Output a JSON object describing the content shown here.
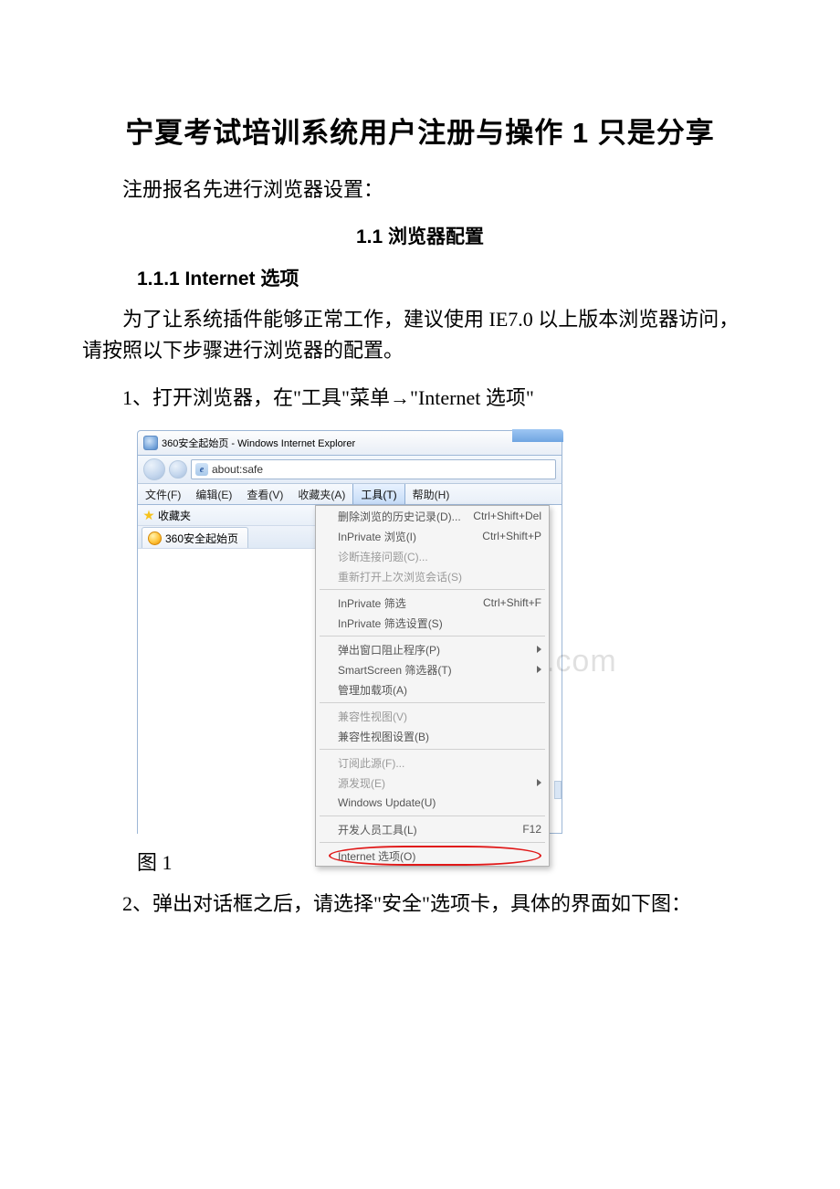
{
  "title": "宁夏考试培训系统用户注册与操作 1 只是分享",
  "intro": "注册报名先进行浏览器设置：",
  "h2": "1.1 浏览器配置",
  "h3": "1.1.1  Internet 选项",
  "para1": "为了让系统插件能够正常工作，建议使用 IE7.0 以上版本浏览器访问，请按照以下步骤进行浏览器的配置。",
  "step1": "1、打开浏览器，在\"工具\"菜单→\"Internet 选项\"",
  "figcap": "图 1",
  "step2": "2、弹出对话框之后，请选择\"安全\"选项卡，具体的界面如下图：",
  "shot": {
    "title": "360安全起始页 - Windows Internet Explorer",
    "addr": "about:safe",
    "menubar": [
      "文件(F)",
      "编辑(E)",
      "查看(V)",
      "收藏夹(A)",
      "工具(T)",
      "帮助(H)"
    ],
    "fav_label": "收藏夹",
    "tab_label": "360安全起始页",
    "watermark": "www.bdocx.com",
    "menu": {
      "g1": [
        {
          "label": "删除浏览的历史记录(D)...",
          "shortcut": "Ctrl+Shift+Del",
          "dim": false
        },
        {
          "label": "InPrivate 浏览(I)",
          "shortcut": "Ctrl+Shift+P",
          "dim": false
        },
        {
          "label": "诊断连接问题(C)...",
          "shortcut": "",
          "dim": true
        },
        {
          "label": "重新打开上次浏览会话(S)",
          "shortcut": "",
          "dim": true
        }
      ],
      "g2": [
        {
          "label": "InPrivate 筛选",
          "shortcut": "Ctrl+Shift+F",
          "dim": false
        },
        {
          "label": "InPrivate 筛选设置(S)",
          "shortcut": "",
          "dim": false
        }
      ],
      "g3": [
        {
          "label": "弹出窗口阻止程序(P)",
          "sub": true
        },
        {
          "label": "SmartScreen 筛选器(T)",
          "sub": true
        },
        {
          "label": "管理加载项(A)"
        }
      ],
      "g4": [
        {
          "label": "兼容性视图(V)",
          "dim": true
        },
        {
          "label": "兼容性视图设置(B)"
        }
      ],
      "g5": [
        {
          "label": "订阅此源(F)...",
          "dim": true
        },
        {
          "label": "源发现(E)",
          "sub": true,
          "dim": true
        },
        {
          "label": "Windows Update(U)"
        }
      ],
      "g6": [
        {
          "label": "开发人员工具(L)",
          "shortcut": "F12"
        }
      ],
      "g7": [
        {
          "label": "Internet 选项(O)",
          "selected": true
        }
      ]
    }
  }
}
